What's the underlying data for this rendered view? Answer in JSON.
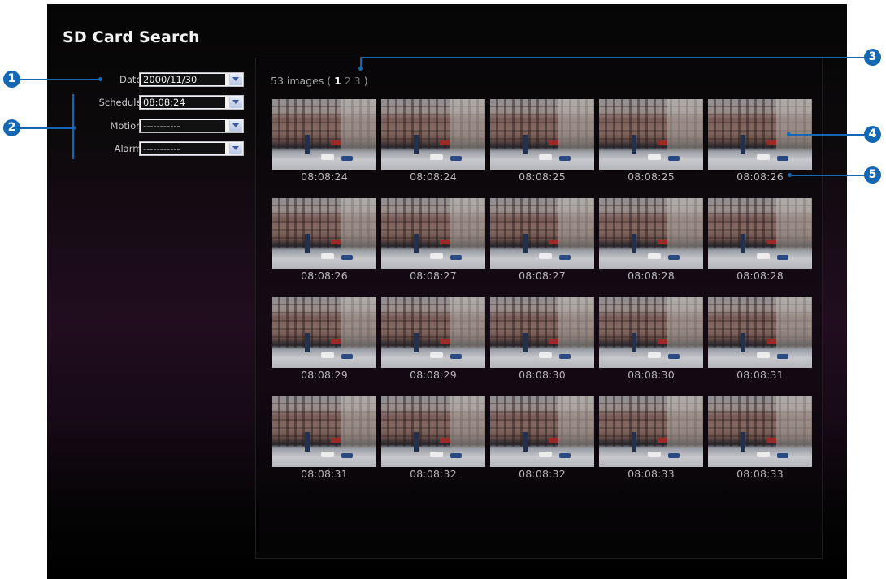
{
  "title": "SD Card Search",
  "filters": [
    {
      "label": "Date :",
      "value": "2000/11/30"
    },
    {
      "label": "Schedule :",
      "value": "08:08:24"
    },
    {
      "label": "Motion :",
      "value": "-----------"
    },
    {
      "label": "Alarm :",
      "value": "-----------"
    }
  ],
  "results": {
    "count_text": "53 images (",
    "pages": [
      "1",
      "2",
      "3"
    ],
    "close_paren": ")",
    "thumbnails": [
      "08:08:24",
      "08:08:24",
      "08:08:25",
      "08:08:25",
      "08:08:26",
      "08:08:26",
      "08:08:27",
      "08:08:27",
      "08:08:28",
      "08:08:28",
      "08:08:29",
      "08:08:29",
      "08:08:30",
      "08:08:30",
      "08:08:31",
      "08:08:31",
      "08:08:32",
      "08:08:32",
      "08:08:33",
      "08:08:33"
    ]
  },
  "callouts": [
    "1",
    "2",
    "3",
    "4",
    "5"
  ],
  "colors": {
    "accent": "#1467b3",
    "background": "#000000"
  },
  "icons": {
    "dropdown": "chevron-down-icon"
  }
}
